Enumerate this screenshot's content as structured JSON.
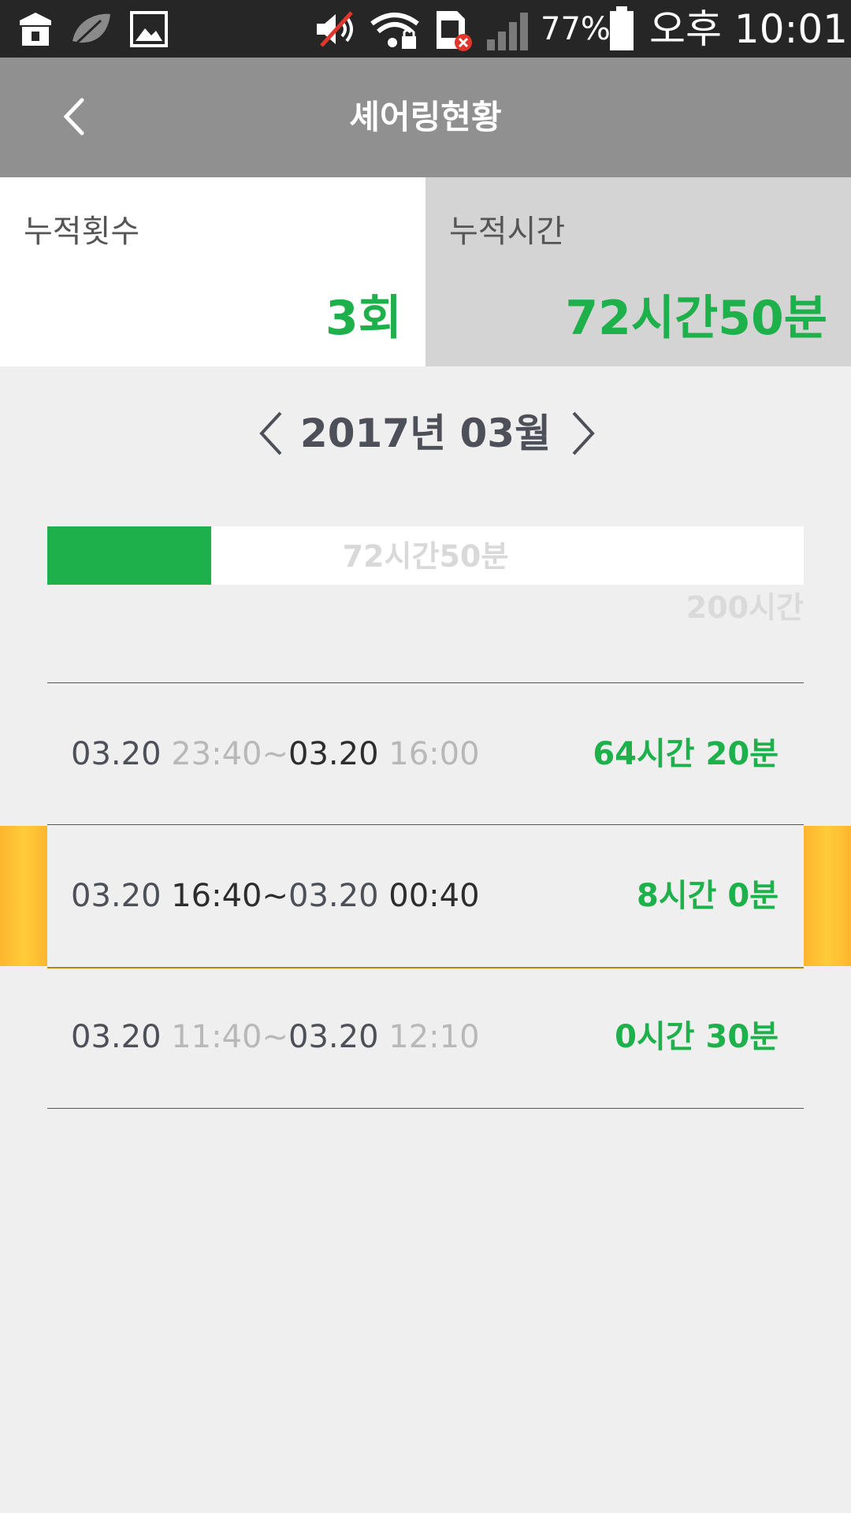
{
  "status_bar": {
    "battery_percent": "77%",
    "time": "오후 10:01",
    "icons": [
      "store-icon",
      "leaf-icon",
      "gallery-icon",
      "mute-icon",
      "wifi-lock-icon",
      "no-sim-icon",
      "signal-icon",
      "battery-icon"
    ]
  },
  "app_bar": {
    "title": "셰어링현황",
    "back_icon": "chevron-left-icon"
  },
  "summary": {
    "count_label": "누적횟수",
    "count_value": "3회",
    "time_label": "누적시간",
    "time_value": "72시간50분"
  },
  "month_nav": {
    "label": "2017년 03월",
    "prev_icon": "chevron-left-icon",
    "next_icon": "chevron-right-icon"
  },
  "progress": {
    "text": "72시간50분",
    "max_text": "200시간",
    "fraction": 0.217
  },
  "rows": [
    {
      "start_date": "03.20",
      "start_time": "23:40",
      "sep": "~",
      "end_date": "03.20",
      "end_time": "16:00",
      "duration": "64시간 20분",
      "highlighted": false
    },
    {
      "start_date": "03.20",
      "start_time": "16:40",
      "sep": "~",
      "end_date": "03.20",
      "end_time": "00:40",
      "duration": "8시간 0분",
      "highlighted": true
    },
    {
      "start_date": "03.20",
      "start_time": "11:40",
      "sep": "~",
      "end_date": "03.20",
      "end_time": "12:10",
      "duration": "0시간 30분",
      "highlighted": false
    }
  ],
  "colors": {
    "accent_green": "#1eb04b",
    "app_bar": "#909090",
    "highlight": "#fdb62e"
  }
}
